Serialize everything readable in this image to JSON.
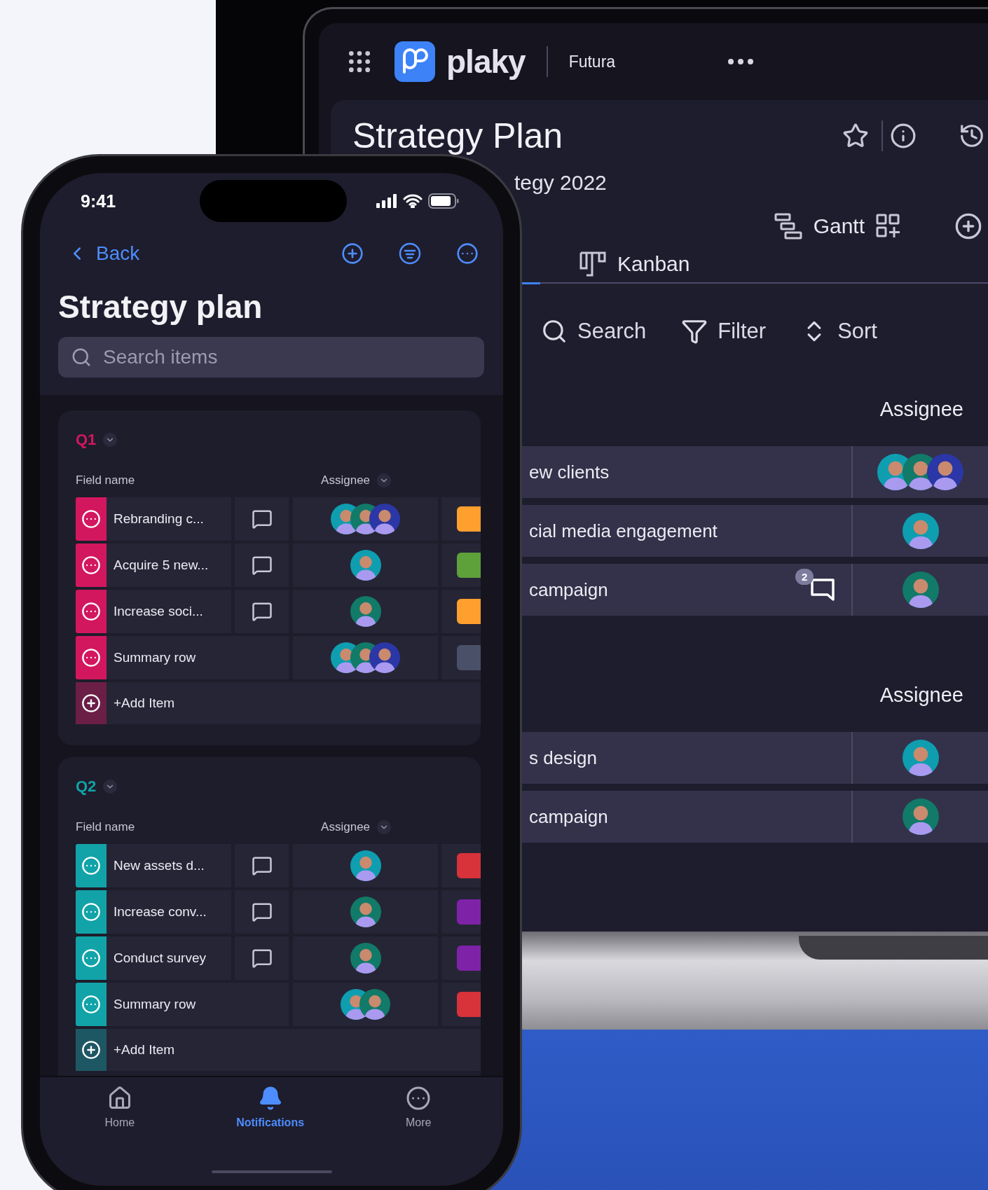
{
  "laptop": {
    "app_bar": {
      "logo_text": "plaky",
      "workspace": "Futura"
    },
    "board": {
      "title": "Strategy Plan",
      "subtitle": "tegy 2022",
      "views": [
        {
          "label": "Gantt",
          "kind": "gantt"
        },
        {
          "label": "Kanban",
          "kind": "kanban"
        }
      ],
      "toolbar": [
        {
          "label": "Search",
          "kind": "search"
        },
        {
          "label": "Filter",
          "kind": "filter"
        },
        {
          "label": "Sort",
          "kind": "sort"
        }
      ],
      "groups": [
        {
          "column": "Assignee",
          "rows": [
            {
              "name": "ew clients",
              "assignees": [
                {
                  "color": "#0e9eb0"
                },
                {
                  "color": "#117a68"
                },
                {
                  "color": "#2b37a6"
                }
              ]
            },
            {
              "name": "cial media engagement",
              "assignees": [
                {
                  "color": "#0e9eb0"
                }
              ]
            },
            {
              "name": "campaign",
              "comment_count": "2",
              "assignees": [
                {
                  "color": "#117a68"
                }
              ]
            }
          ]
        },
        {
          "column": "Assignee",
          "rows": [
            {
              "name": "s design",
              "assignees": [
                {
                  "color": "#0e9eb0"
                }
              ]
            },
            {
              "name": "campaign",
              "assignees": [
                {
                  "color": "#117a68"
                }
              ]
            }
          ]
        }
      ]
    }
  },
  "phone": {
    "status_bar": {
      "time": "9:41"
    },
    "nav": {
      "back": "Back"
    },
    "title": "Strategy plan",
    "search": {
      "placeholder": "Search items"
    },
    "groups": [
      {
        "name": "Q1",
        "color": "#d3175f",
        "columns": [
          "Field name",
          "Assignee"
        ],
        "add_label": "+Add Item",
        "rows": [
          {
            "kind": "item",
            "name": "Rebranding c...",
            "color": "#ff9f2e",
            "assignees": [
              {
                "color": "#0e9eb0"
              },
              {
                "color": "#117a68"
              },
              {
                "color": "#2b37a6"
              }
            ]
          },
          {
            "kind": "item",
            "name": "Acquire 5 new...",
            "color": "#5ea03a",
            "assignees": [
              {
                "color": "#0e9eb0"
              }
            ]
          },
          {
            "kind": "item",
            "name": "Increase soci...",
            "color": "#ff9f2e",
            "assignees": [
              {
                "color": "#117a68"
              }
            ]
          },
          {
            "kind": "summary",
            "name": "Summary row",
            "color": "#4a5068",
            "assignees": [
              {
                "color": "#0e9eb0"
              },
              {
                "color": "#117a68"
              },
              {
                "color": "#2b37a6"
              }
            ]
          }
        ]
      },
      {
        "name": "Q2",
        "color": "#11a3a8",
        "columns": [
          "Field name",
          "Assignee"
        ],
        "add_label": "+Add Item",
        "rows": [
          {
            "kind": "item",
            "name": "New assets d...",
            "color": "#d8323a",
            "assignees": [
              {
                "color": "#0e9eb0"
              }
            ]
          },
          {
            "kind": "item",
            "name": "Increase conv...",
            "color": "#7e22a8",
            "assignees": [
              {
                "color": "#117a68"
              }
            ]
          },
          {
            "kind": "item",
            "name": "Conduct survey",
            "color": "#7e22a8",
            "assignees": [
              {
                "color": "#117a68"
              }
            ]
          },
          {
            "kind": "summary",
            "name": "Summary row",
            "color": "#d8323a",
            "assignees": [
              {
                "color": "#0e9eb0"
              },
              {
                "color": "#117a68"
              }
            ]
          }
        ]
      }
    ],
    "tab_bar": [
      {
        "label": "Home",
        "kind": "home",
        "selected": false
      },
      {
        "label": "Notifications",
        "kind": "bell",
        "selected": true
      },
      {
        "label": "More",
        "kind": "more",
        "selected": false
      }
    ]
  }
}
